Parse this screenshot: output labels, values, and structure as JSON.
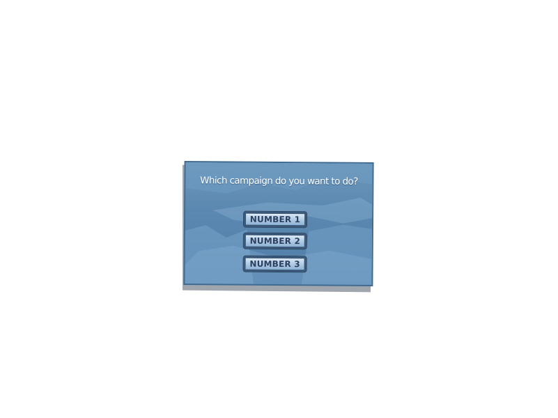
{
  "dialog": {
    "question": "Which campaign do you want to do?",
    "options": [
      {
        "label": "NUMBER 1"
      },
      {
        "label": "NUMBER 2"
      },
      {
        "label": "NUMBER 3"
      }
    ]
  },
  "colors": {
    "panel": "#5b88b0",
    "panel_border": "#3f6b92",
    "button_fill": "#a9c6e2",
    "button_border": "#3b5879",
    "button_text": "#2c3f5e",
    "shadow": "#9fa6ad"
  }
}
